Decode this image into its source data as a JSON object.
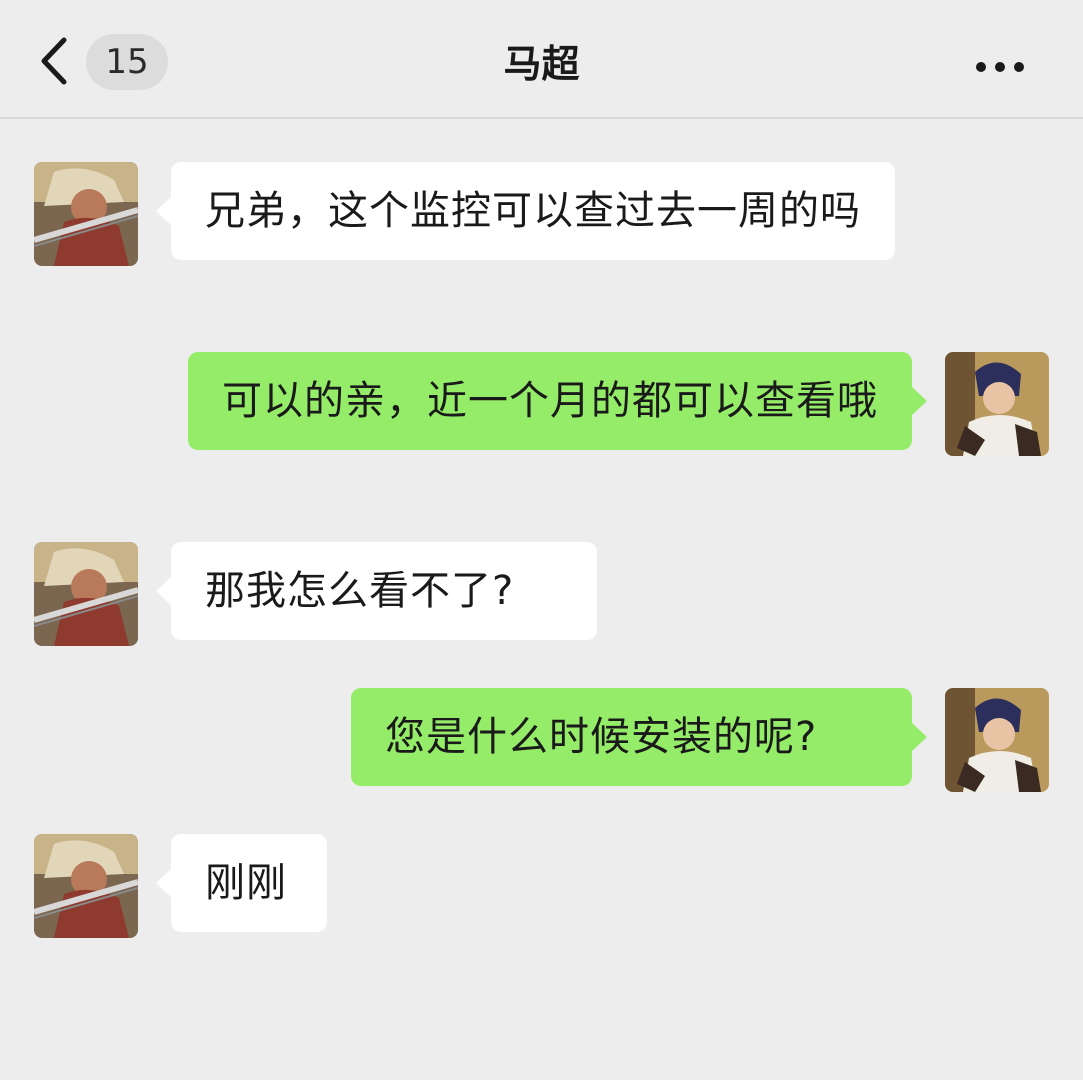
{
  "header": {
    "title": "马超",
    "unread_count": "15",
    "back_icon": "chevron-left-icon",
    "more_icon": "more-dots-icon"
  },
  "colors": {
    "background": "#ededed",
    "incoming_bubble": "#ffffff",
    "outgoing_bubble": "#95ec69"
  },
  "messages": [
    {
      "side": "incoming",
      "text": "兄弟，这个监控可以查过去一周的吗"
    },
    {
      "side": "outgoing",
      "text": "可以的亲，近一个月的都可以查看哦"
    },
    {
      "side": "incoming",
      "text": "那我怎么看不了?"
    },
    {
      "side": "outgoing",
      "text": "您是什么时候安装的呢?"
    },
    {
      "side": "incoming",
      "text": "刚刚"
    }
  ]
}
